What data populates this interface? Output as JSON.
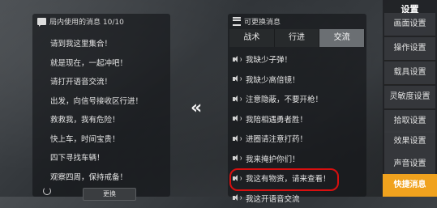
{
  "left_panel": {
    "title": "局内使用的消息 10/10",
    "items": [
      "请到我这里集合！",
      "就是现在，一起冲吧！",
      "请打开语音交流！",
      "出发，向信号接收区行进！",
      "救救我，我有危险！",
      "快上车，时间宝贵！",
      "四下寻找车辆！",
      "观察四周，保持戒备！"
    ],
    "edit_label": "更换"
  },
  "switch_arrows": "«",
  "right_panel": {
    "title": "可更换消息",
    "tabs": [
      "战术",
      "行进",
      "交流"
    ],
    "active_tab": 2,
    "items": [
      "我缺少子弹！",
      "我缺少高倍镜！",
      "注意隐蔽，不要开枪！",
      "我陪相遇勇者胜！",
      "进圈请注意打药！",
      "我来掩护你们！",
      "我这有物资，请来查看！",
      "我这开语音交流"
    ]
  },
  "sidebar": {
    "title": "设置",
    "items": [
      "画面设置",
      "操作设置",
      "载具设置",
      "灵敏度设置",
      "拾取设置",
      "效果设置",
      "声音设置"
    ],
    "quick_message": "快捷消息"
  },
  "colors": {
    "accent": "#f0a21e",
    "highlight": "#d80f0f",
    "active_tab": "#6b6f73"
  }
}
